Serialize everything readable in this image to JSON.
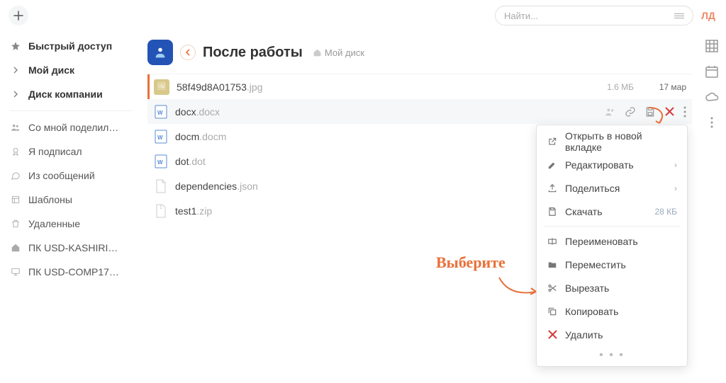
{
  "top": {
    "search_placeholder": "Найти...",
    "user_initials": "ЛД"
  },
  "sidebar": {
    "quick": "Быстрый доступ",
    "mydisk": "Мой диск",
    "company": "Диск компании",
    "shared": "Со мной поделил…",
    "signed": "Я подписал",
    "messages": "Из сообщений",
    "templates": "Шаблоны",
    "deleted": "Удаленные",
    "pc1": "ПК USD-KASHIRI…",
    "pc2": "ПК USD-COMP17…"
  },
  "header": {
    "title": "После работы",
    "breadcrumb": "Мой диск"
  },
  "files": [
    {
      "name": "58f49d8A01753",
      "ext": ".jpg",
      "size": "1.6 МБ",
      "date": "17 мар",
      "icon": "thumb"
    },
    {
      "name": "docx",
      "ext": ".docx",
      "icon": "word",
      "selected": true,
      "actions": true
    },
    {
      "name": "docm",
      "ext": ".docm",
      "icon": "word"
    },
    {
      "name": "dot",
      "ext": ".dot",
      "icon": "word"
    },
    {
      "name": "dependencies",
      "ext": ".json",
      "icon": "file"
    },
    {
      "name": "test1",
      "ext": ".zip",
      "icon": "zip"
    }
  ],
  "ctx": {
    "open_tab": "Открыть в новой вкладке",
    "edit": "Редактировать",
    "share": "Поделиться",
    "download": "Скачать",
    "download_size": "28 КБ",
    "rename": "Переименовать",
    "move": "Переместить",
    "cut": "Вырезать",
    "copy": "Копировать",
    "delete": "Удалить"
  },
  "annotation": {
    "label": "Выберите"
  }
}
